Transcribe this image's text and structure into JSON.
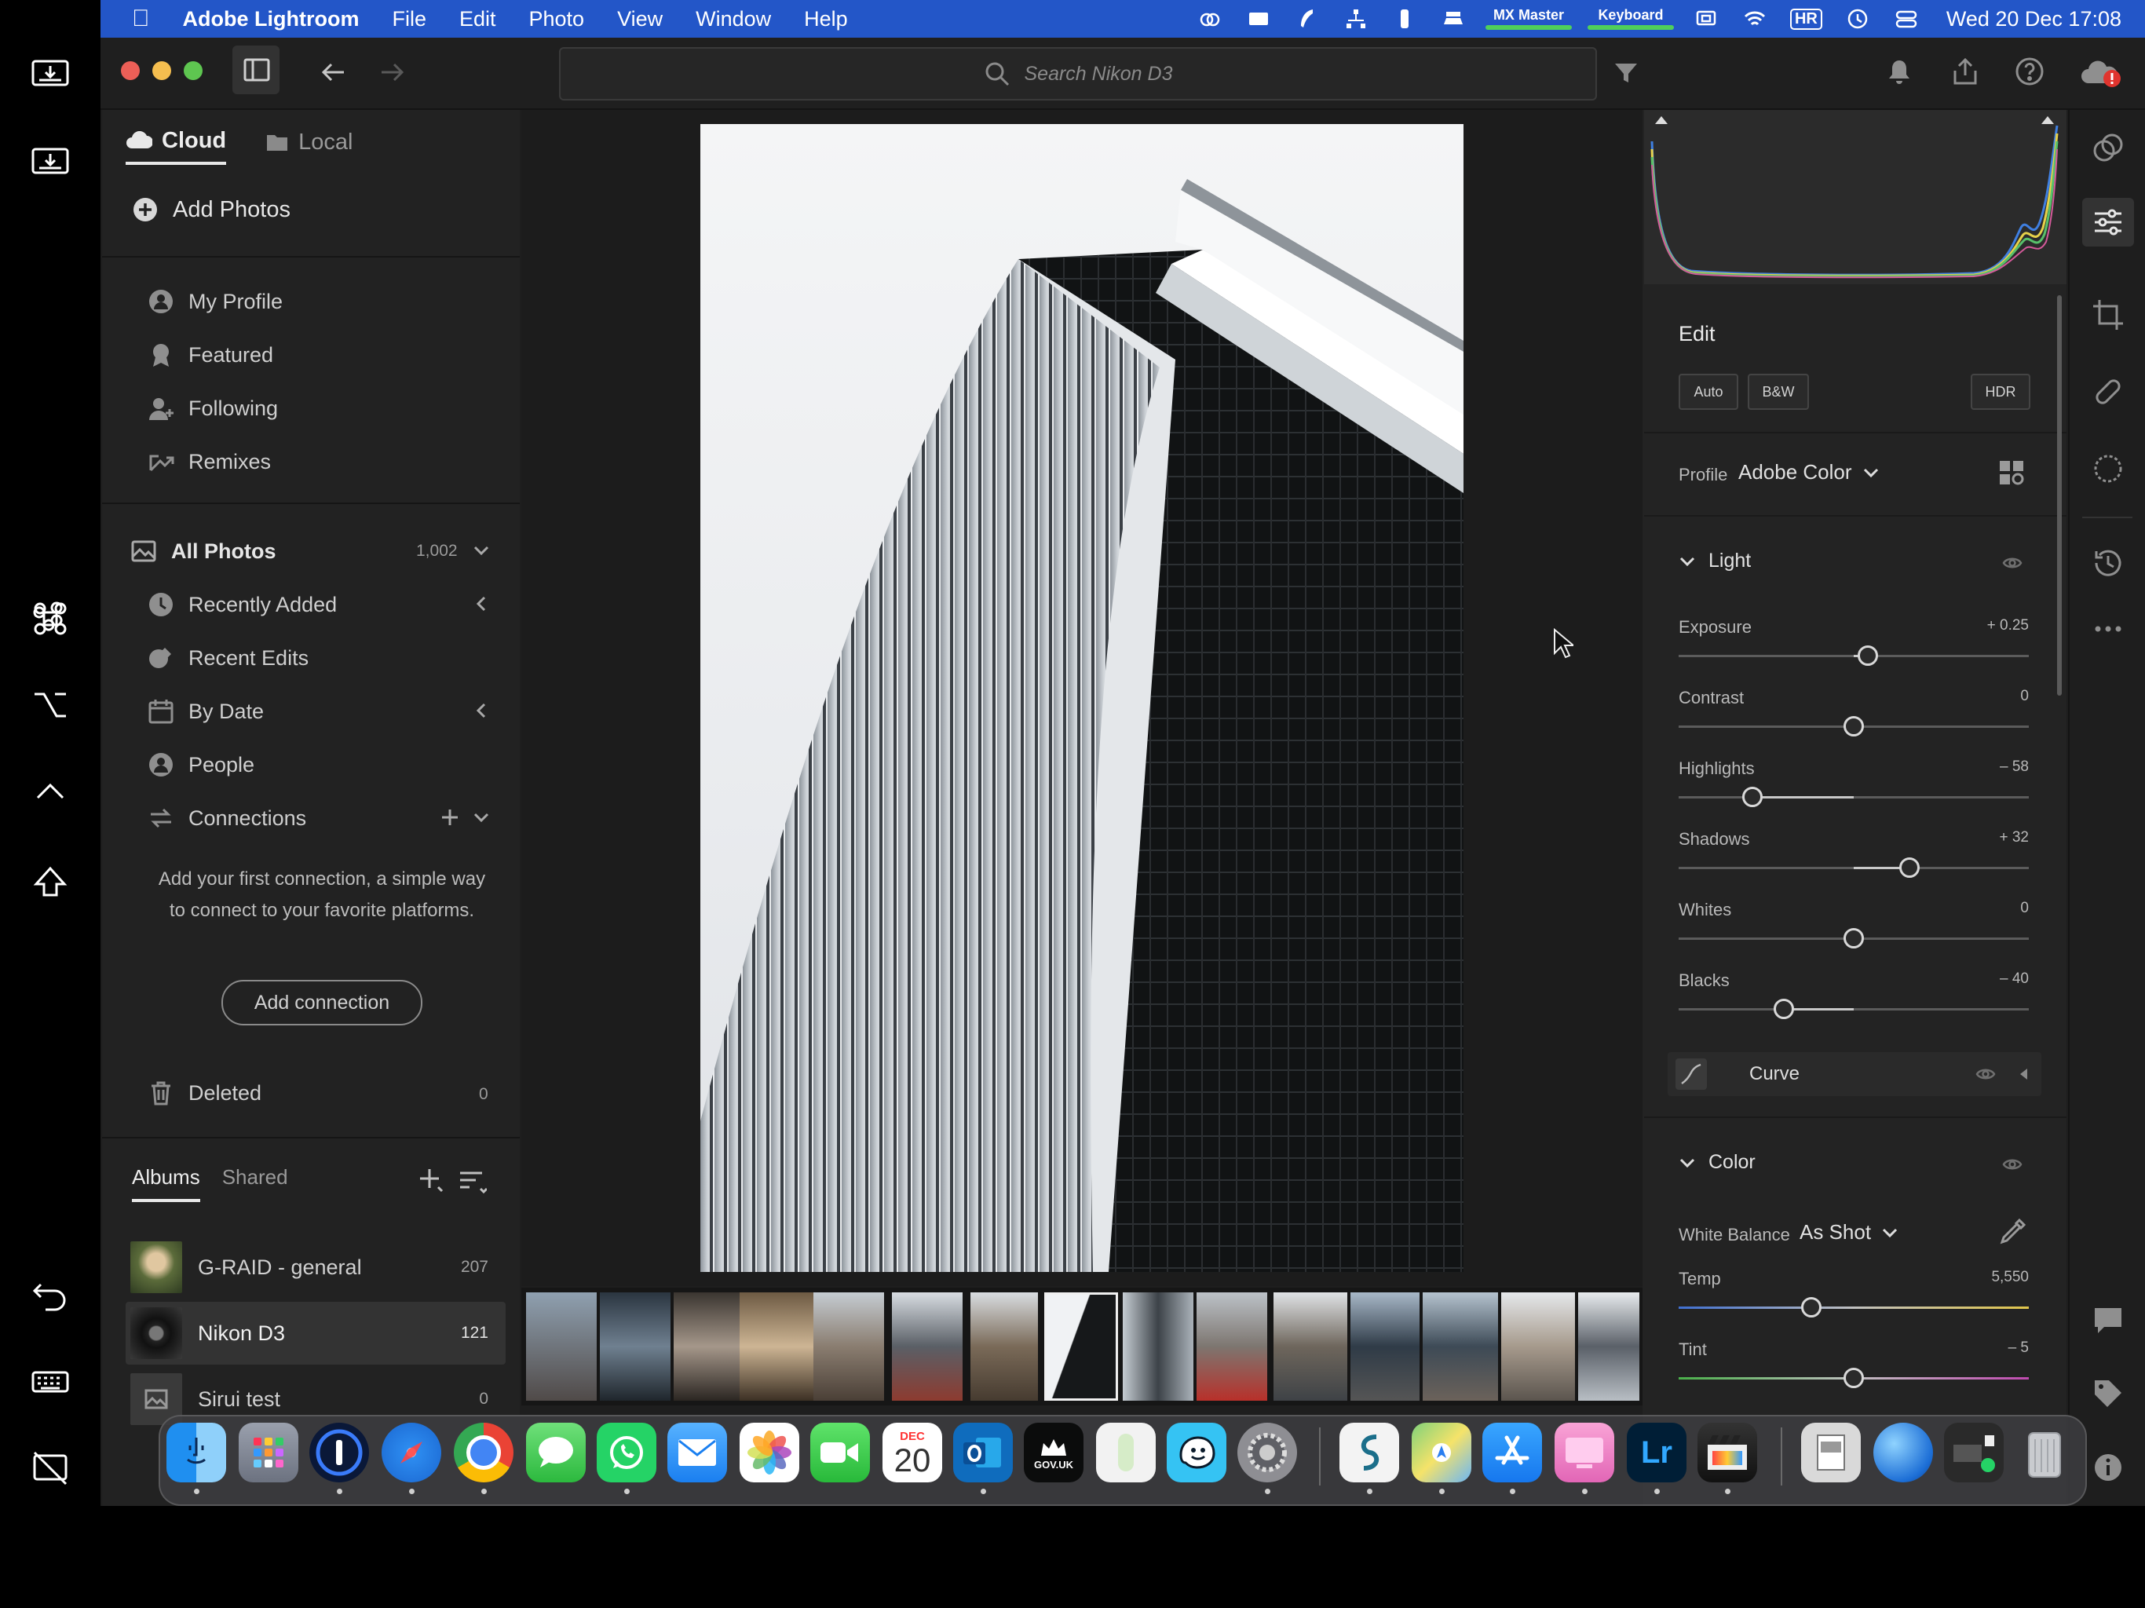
{
  "menubar": {
    "app_name": "Adobe Lightroom",
    "menus": [
      "File",
      "Edit",
      "Photo",
      "View",
      "Window",
      "Help"
    ],
    "mouse_label": "MX Master",
    "keyboard_label": "Keyboard",
    "hr_badge": "HR",
    "clock": "Wed 20 Dec  17:08"
  },
  "toolbar": {
    "search_placeholder": "Search Nikon D3"
  },
  "sidebar": {
    "tab_cloud": "Cloud",
    "tab_local": "Local",
    "add_photos": "Add Photos",
    "community": [
      "My Profile",
      "Featured",
      "Following",
      "Remixes"
    ],
    "all_photos": "All Photos",
    "all_photos_count": "1,002",
    "library": [
      "Recently Added",
      "Recent Edits",
      "By Date",
      "People"
    ],
    "connections": "Connections",
    "connection_hint": "Add your first connection, a simple way to connect to your favorite platforms.",
    "add_connection": "Add connection",
    "deleted": "Deleted",
    "deleted_count": "0"
  },
  "albums": {
    "tab_albums": "Albums",
    "tab_shared": "Shared",
    "items": [
      {
        "name": "G-RAID - general",
        "count": "207"
      },
      {
        "name": "Nikon D3",
        "count": "121"
      },
      {
        "name": "Sirui test",
        "count": "0"
      }
    ]
  },
  "edit": {
    "title": "Edit",
    "auto": "Auto",
    "bw": "B&W",
    "hdr": "HDR",
    "profile_label": "Profile",
    "profile_value": "Adobe Color",
    "light_title": "Light",
    "sliders": [
      {
        "label": "Exposure",
        "value": "+ 0.25",
        "level": 0.54
      },
      {
        "label": "Contrast",
        "value": "0",
        "level": 0.5
      },
      {
        "label": "Highlights",
        "value": "– 58",
        "level": 0.21
      },
      {
        "label": "Shadows",
        "value": "+ 32",
        "level": 0.66
      },
      {
        "label": "Whites",
        "value": "0",
        "level": 0.5
      },
      {
        "label": "Blacks",
        "value": "– 40",
        "level": 0.3
      }
    ],
    "curve": "Curve",
    "color_title": "Color",
    "wb_label": "White Balance",
    "wb_value": "As Shot",
    "temp_label": "Temp",
    "temp_value": "5,550",
    "temp_level": 0.38,
    "tint_label": "Tint",
    "tint_value": "– 5",
    "tint_level": 0.5
  },
  "dock": {
    "calendar_month": "DEC",
    "calendar_day": "20",
    "gov_label": "GOV.UK",
    "lr_label": "Lr"
  }
}
